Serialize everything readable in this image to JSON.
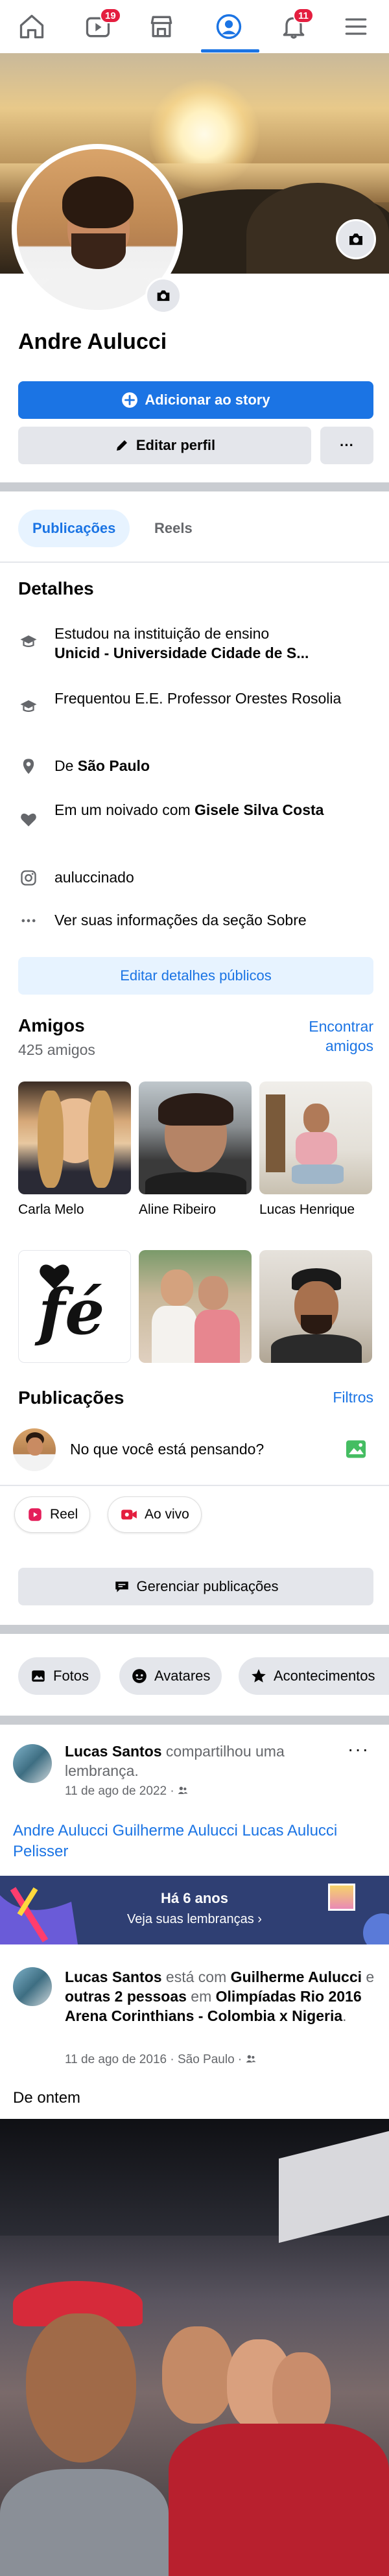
{
  "nav": {
    "video_badge": "19",
    "notif_badge": "11"
  },
  "profile": {
    "name": "Andre Aulucci",
    "add_story": "Adicionar ao story",
    "edit_profile": "Editar perfil",
    "more": "···"
  },
  "tabs": {
    "posts": "Publicações",
    "reels": "Reels"
  },
  "details": {
    "title": "Detalhes",
    "items": [
      {
        "icon": "graduation-cap-icon",
        "pre": "Estudou na instituição de ensino",
        "bold": "Unicid - Universidade Cidade de S..."
      },
      {
        "icon": "graduation-cap-icon",
        "pre": "Frequentou E.E. Professor Orestes Rosolia",
        "bold": ""
      },
      {
        "icon": "location-pin-icon",
        "pre": "De ",
        "bold": "São Paulo"
      },
      {
        "icon": "heart-icon",
        "pre": "Em um noivado com ",
        "bold": "Gisele Silva Costa"
      },
      {
        "icon": "instagram-icon",
        "pre": "auluccinado",
        "bold": ""
      },
      {
        "icon": "more-dots-icon",
        "pre": "Ver suas informações da seção Sobre",
        "bold": ""
      }
    ],
    "edit_public": "Editar detalhes públicos"
  },
  "friends": {
    "title": "Amigos",
    "count": "425 amigos",
    "find_line1": "Encontrar",
    "find_line2": "amigos",
    "list": [
      {
        "name": "Carla Melo"
      },
      {
        "name": "Aline Ribeiro"
      },
      {
        "name": "Lucas Henrique"
      },
      {
        "name": ""
      },
      {
        "name": ""
      },
      {
        "name": ""
      }
    ],
    "fe_text": "fé"
  },
  "posts_section": {
    "title": "Publicações",
    "filters": "Filtros",
    "composer": "No que você está pensando?",
    "reel": "Reel",
    "live": "Ao vivo",
    "manage": "Gerenciar publicações",
    "chips": [
      "Fotos",
      "Avatares",
      "Acontecimentos"
    ]
  },
  "post1": {
    "author": "Lucas Santos",
    "action": " compartilhou uma lembrança.",
    "meta": "11 de ago de 2022 · ",
    "body": "Andre Aulucci Guilherme Aulucci Lucas Aulucci Pelisser",
    "memory_title": "Há 6 anos",
    "memory_sub": "Veja suas lembranças ›"
  },
  "post2": {
    "author": "Lucas Santos",
    "mid1": " está com ",
    "with1": "Guilherme Aulucci",
    "mid2": " e ",
    "with2": "outras 2 pessoas",
    "mid3": " em ",
    "place": "Olimpíadas Rio 2016 Arena Corinthians - Colombia x Nigeria",
    "end": ".",
    "meta": "11 de ago de 2016 · São Paulo · ",
    "caption": "De ontem"
  },
  "colors": {
    "accent": "#1b74e4",
    "badge": "#e41e3f",
    "light_accent": "#e7f3ff",
    "grey_button": "#e4e6eb"
  }
}
